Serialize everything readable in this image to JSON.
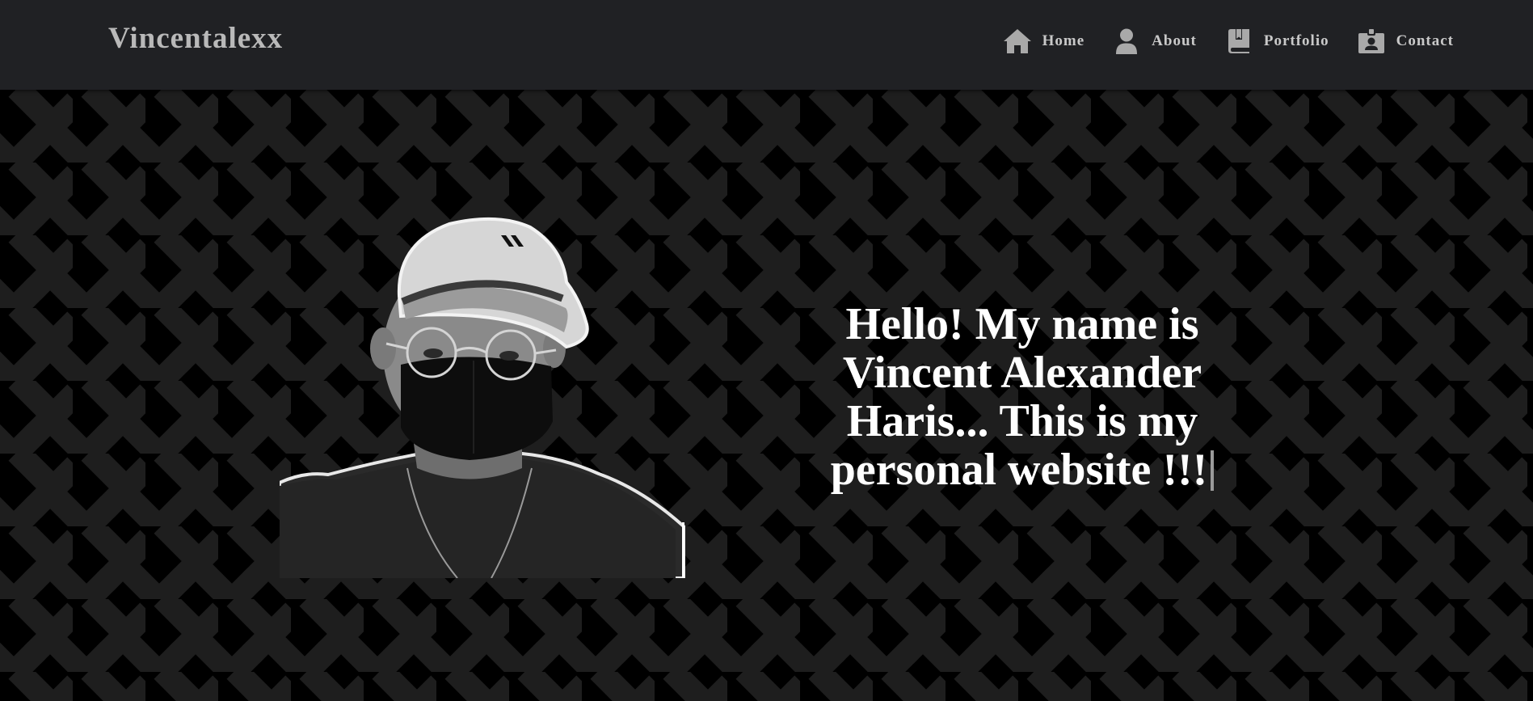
{
  "brand": "Vincentalexx",
  "nav": [
    {
      "label": "Home",
      "icon": "home-icon"
    },
    {
      "label": "About",
      "icon": "user-icon"
    },
    {
      "label": "Portfolio",
      "icon": "book-icon"
    },
    {
      "label": "Contact",
      "icon": "id-badge-icon"
    }
  ],
  "hero": {
    "headline": "Hello! My name is Vincent Alexander Haris... This is my personal website !!!",
    "photo": "profile-photo"
  },
  "colors": {
    "navbar": "#202124",
    "background": "#000000",
    "pattern": "#1e1e1e",
    "text": "#ffffff",
    "nav_text": "#c9c9c9"
  }
}
